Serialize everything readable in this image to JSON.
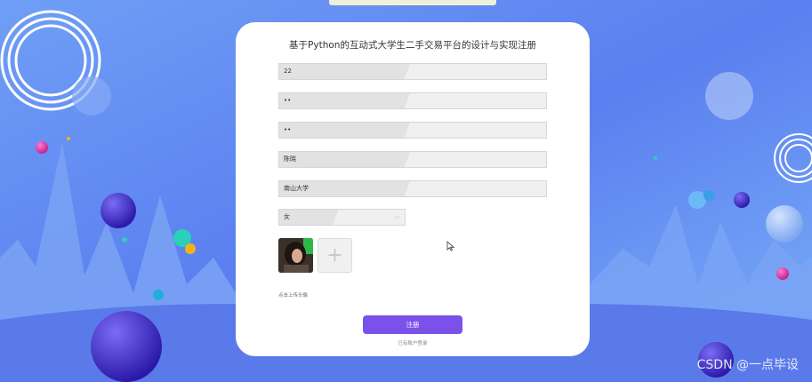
{
  "page": {
    "title": "基于Python的互动式大学生二手交易平台的设计与实现注册"
  },
  "form": {
    "fields": [
      {
        "name": "account",
        "value": "22"
      },
      {
        "name": "password",
        "value": "••"
      },
      {
        "name": "confirm_password",
        "value": "••"
      },
      {
        "name": "name",
        "value": "陈晓"
      },
      {
        "name": "school",
        "value": "南山大学"
      }
    ],
    "gender": {
      "value": "女",
      "options": [
        "女"
      ]
    },
    "avatar_hint": "点击上传头像",
    "submit_label": "注册",
    "login_link": "已有账户登录"
  },
  "watermark": "CSDN @一点毕设",
  "colors": {
    "accent": "#7a52ea",
    "background": "#6f8fee"
  },
  "icons": {
    "chevron": "chevron-down-icon",
    "add": "plus-icon",
    "cursor": "mouse-cursor-icon"
  }
}
